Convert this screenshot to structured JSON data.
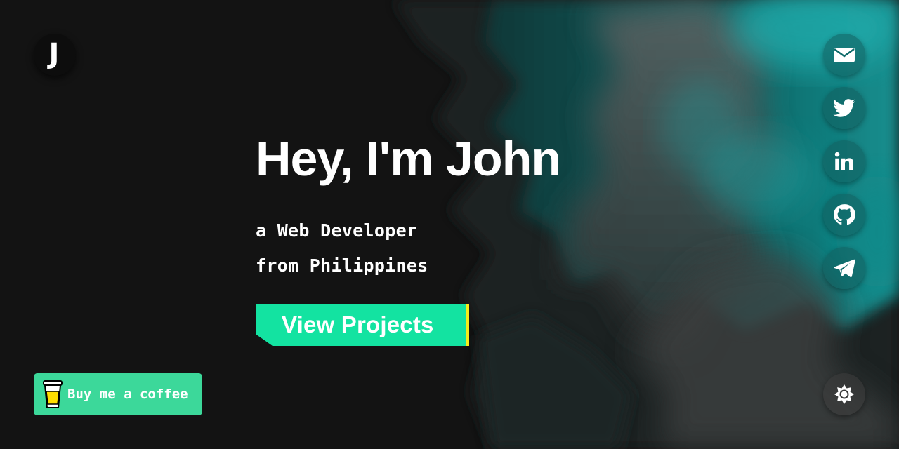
{
  "logo": {
    "letter": "J"
  },
  "hero": {
    "title": "Hey, I'm John",
    "subtitle_line1": "a Web Developer",
    "subtitle_line2": "from Philippines",
    "cta_label": "View Projects"
  },
  "coffee": {
    "label": "Buy me a coffee",
    "icon": "coffee-cup-icon"
  },
  "social": [
    {
      "name": "email",
      "icon": "mail-icon"
    },
    {
      "name": "twitter",
      "icon": "twitter-icon"
    },
    {
      "name": "linkedin",
      "icon": "linkedin-icon"
    },
    {
      "name": "github",
      "icon": "github-icon"
    },
    {
      "name": "telegram",
      "icon": "telegram-icon"
    }
  ],
  "theme_toggle": {
    "icon": "sun-icon"
  },
  "colors": {
    "background": "#131313",
    "accent": "#13e3a1",
    "accent_edge": "#f5ec1b",
    "coffee_button": "#3cd89a",
    "teal": "#0e8c8c"
  }
}
